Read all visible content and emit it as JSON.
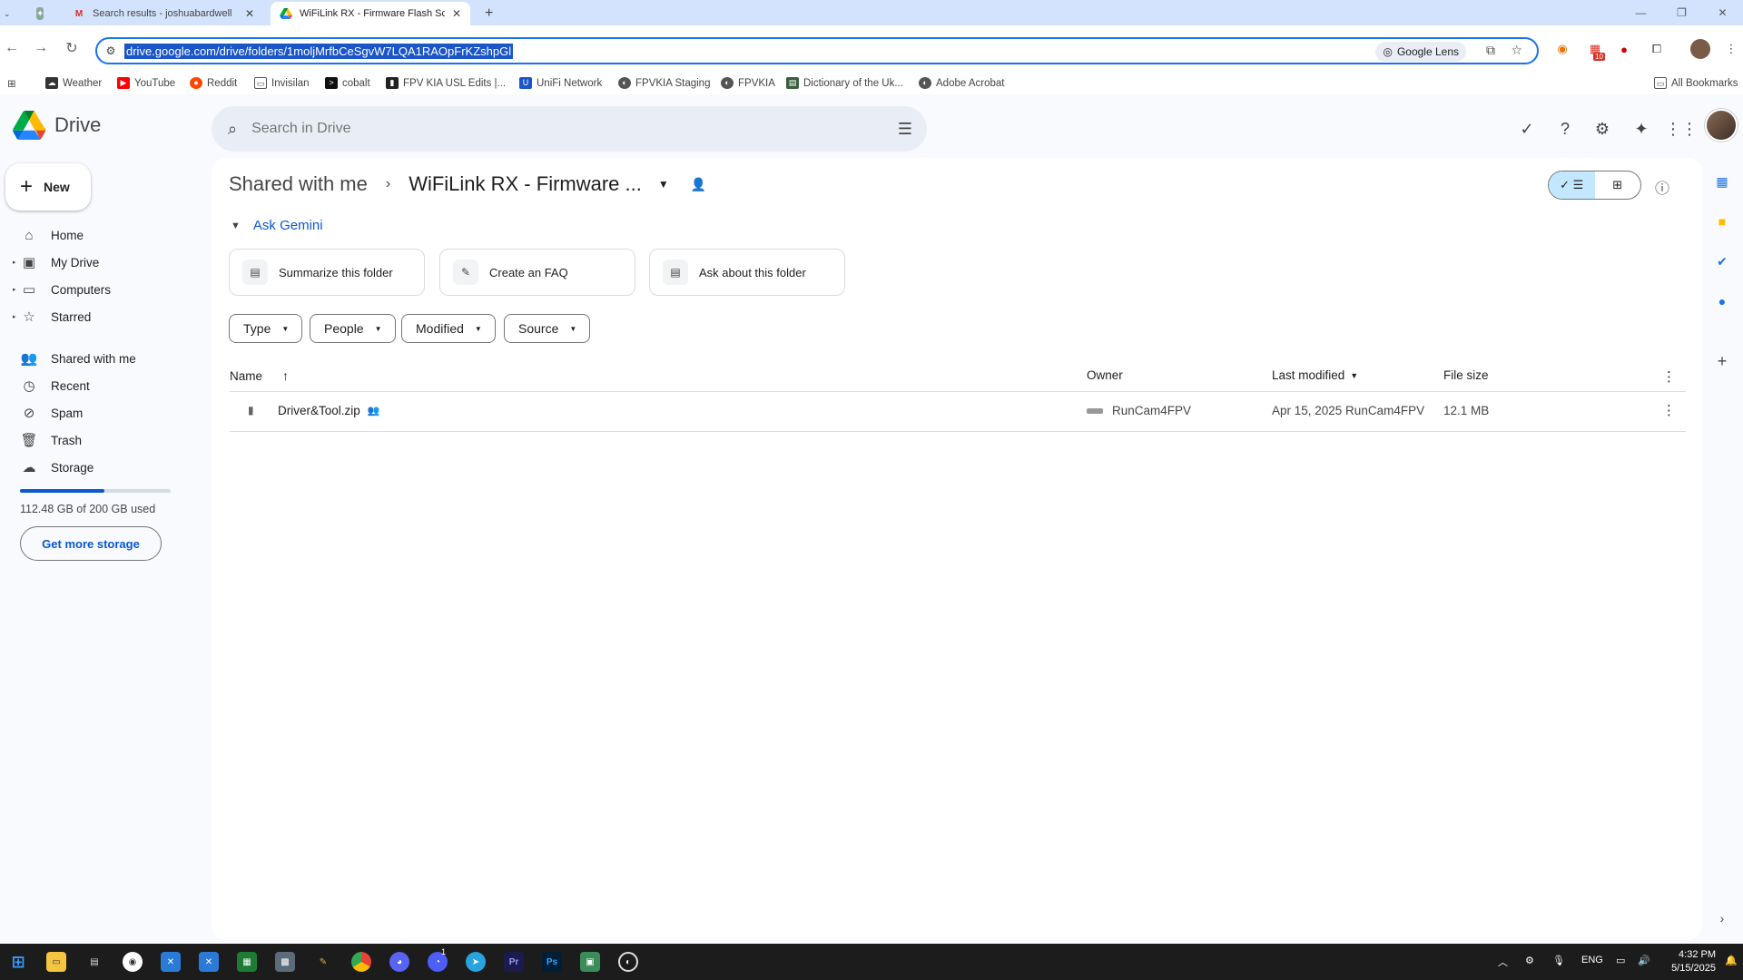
{
  "browser": {
    "tabs": [
      {
        "title": "",
        "favicon": "puzzle"
      },
      {
        "title": "Search results - joshuabardwell",
        "favicon": "gmail"
      },
      {
        "title": "WiFiLink RX - Firmware Flash Sc",
        "favicon": "drive",
        "active": true
      }
    ],
    "new_tab": "+",
    "url": "drive.google.com/drive/folders/1moljMrfbCeSgvW7LQA1RAOpFrKZshpGl",
    "google_lens": "Google Lens",
    "bookmarks": [
      "Weather",
      "YouTube",
      "Reddit",
      "Invisilan",
      "cobalt",
      "FPV KIA USL Edits |...",
      "UniFi Network",
      "FPVKIA Staging",
      "FPVKIA",
      "Dictionary of the Uk...",
      "Adobe Acrobat"
    ],
    "all_bookmarks": "All Bookmarks",
    "ext_badge": "10"
  },
  "drive": {
    "brand": "Drive",
    "search_placeholder": "Search in Drive",
    "new_label": "New",
    "nav": [
      {
        "label": "Home",
        "icon": "home-icon"
      },
      {
        "label": "My Drive",
        "icon": "my-drive-icon"
      },
      {
        "label": "Computers",
        "icon": "computers-icon"
      },
      {
        "label": "Starred",
        "icon": "star-icon"
      },
      {
        "label": "Shared with me",
        "icon": "shared-icon"
      },
      {
        "label": "Recent",
        "icon": "clock-icon"
      },
      {
        "label": "Spam",
        "icon": "spam-icon"
      },
      {
        "label": "Trash",
        "icon": "trash-icon"
      },
      {
        "label": "Storage",
        "icon": "cloud-icon"
      }
    ],
    "storage_used_fraction": 0.56,
    "storage_text": "112.48 GB of 200 GB used",
    "get_storage": "Get more storage",
    "breadcrumb_parent": "Shared with me",
    "breadcrumb_current": "WiFiLink RX - Firmware ...",
    "ask_gemini": "Ask Gemini",
    "gemini_chips": [
      "Summarize this folder",
      "Create an FAQ",
      "Ask about this folder"
    ],
    "filters": [
      "Type",
      "People",
      "Modified",
      "Source"
    ],
    "columns": {
      "name": "Name",
      "owner": "Owner",
      "modified": "Last modified",
      "size": "File size"
    },
    "files": [
      {
        "name": "Driver&Tool.zip",
        "owner": "RunCam4FPV",
        "modified": "Apr 15, 2025 RunCam4FPV",
        "size": "12.1 MB"
      }
    ]
  },
  "taskbar": {
    "lang": "ENG",
    "time": "4:32 PM",
    "date": "5/15/2025",
    "notif_badge": "1"
  },
  "colors": {
    "accent": "#0b57d0",
    "selection": "#1a55c9",
    "tab_strip": "#d3e3fd"
  }
}
